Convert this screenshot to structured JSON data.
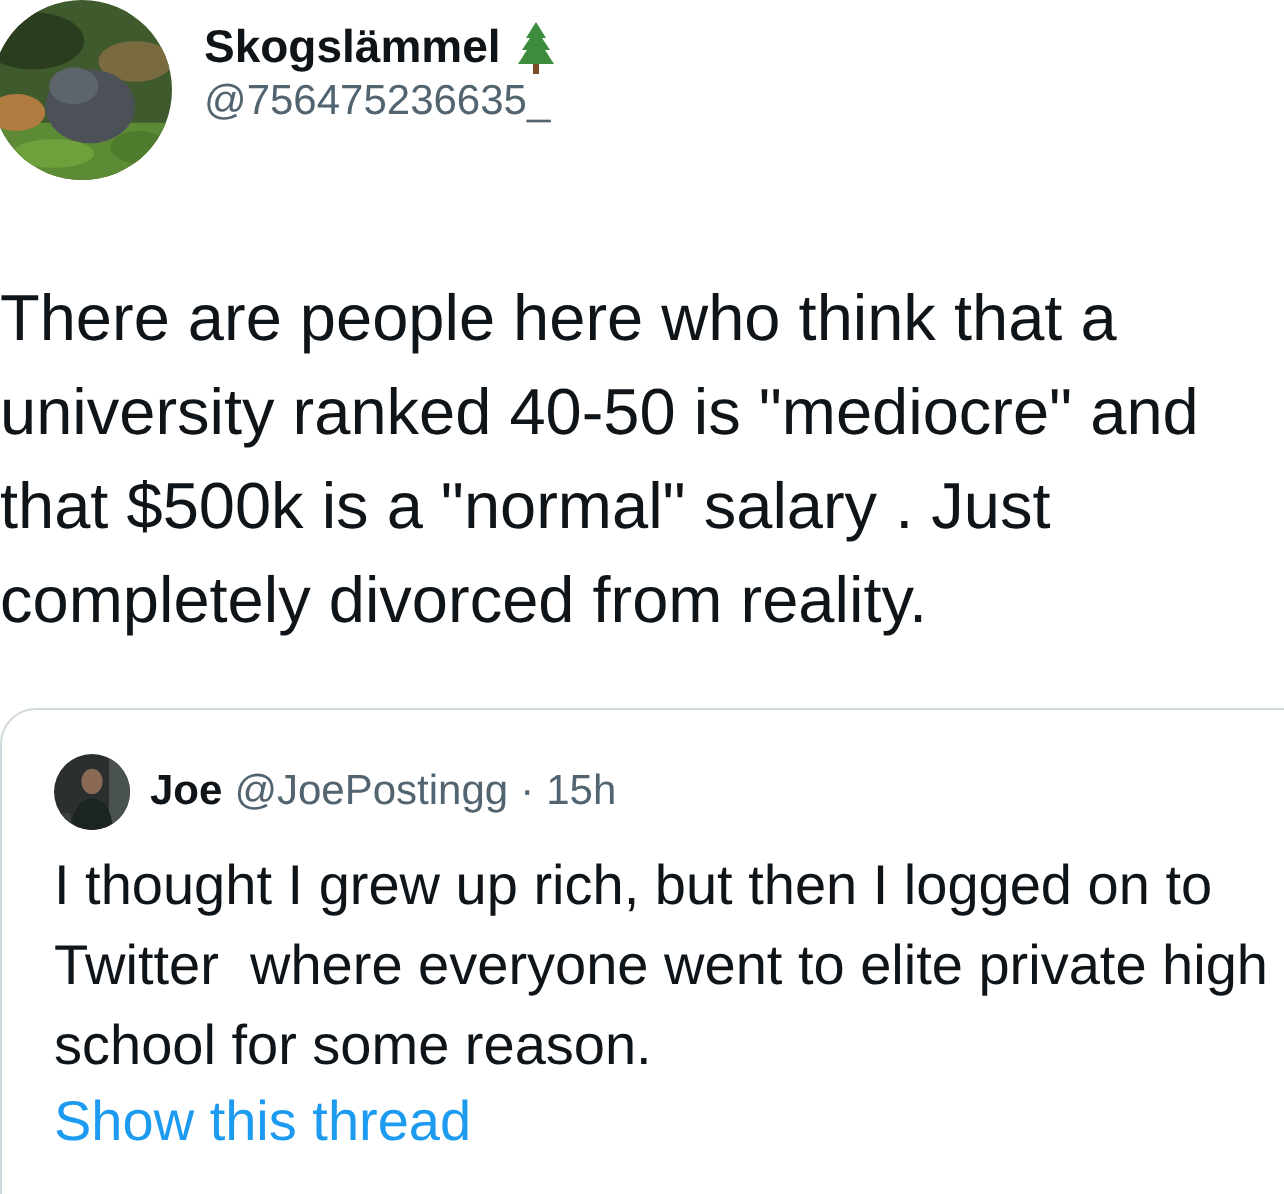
{
  "author": {
    "name": "Skogslämmel",
    "handle": "@756475236635_"
  },
  "text": "There are people here who think that a university ranked 40-50 is \"mediocre\" and that $500k is a \"normal\" salary . Just completely divorced from reality.",
  "quoted": {
    "name": "Joe",
    "handle": "@JoePostingg",
    "separator": "·",
    "time": "15h",
    "text": "I thought I grew up rich, but then I logged on to Twitter  where everyone went to elite private high school for some reason.",
    "link": "Show this thread"
  }
}
